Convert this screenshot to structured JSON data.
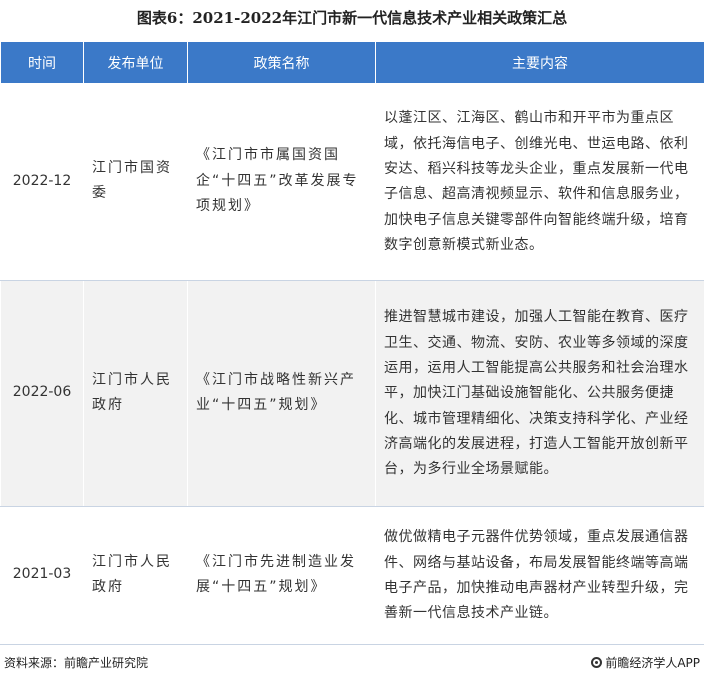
{
  "title": "图表6：2021-2022年江门市新一代信息技术产业相关政策汇总",
  "columns": [
    "时间",
    "发布单位",
    "政策名称",
    "主要内容"
  ],
  "rows": [
    {
      "time": "2022-12",
      "unit": "江门市国资委",
      "policy": "《江门市市属国资国企“十四五”改革发展专项规划》",
      "content": "以蓬江区、江海区、鹤山市和开平市为重点区域，依托海信电子、创维光电、世运电路、依利安达、稻兴科技等龙头企业，重点发展新一代电子信息、超高清视频显示、软件和信息服务业，加快电子信息关键零部件向智能终端升级，培育数字创意新模式新业态。"
    },
    {
      "time": "2022-06",
      "unit": "江门市人民政府",
      "policy": "《江门市战略性新兴产业“十四五”规划》",
      "content": "推进智慧城市建设，加强人工智能在教育、医疗卫生、交通、物流、安防、农业等多领域的深度运用，运用人工智能提高公共服务和社会治理水平，加快江门基础设施智能化、公共服务便捷化、城市管理精细化、决策支持科学化、产业经济高端化的发展进程，打造人工智能开放创新平台，为多行业全场景赋能。"
    },
    {
      "time": "2021-03",
      "unit": "江门市人民政府",
      "policy": "《江门市先进制造业发展“十四五”规划》",
      "content": "做优做精电子元器件优势领域，重点发展通信器件、网络与基站设备，布局发展智能终端等高端电子产品，加快推动电声器材产业转型升级，完善新一代信息技术产业链。"
    }
  ],
  "footer": {
    "source": "资料来源：前瞻产业研究院",
    "brand": "前瞻经济学人APP",
    "brand_icon": "qianzhan-logo-icon"
  },
  "colors": {
    "header_bg": "#3b79c8",
    "header_text": "#ffffff",
    "alt_row_bg": "#f2f2f2"
  }
}
